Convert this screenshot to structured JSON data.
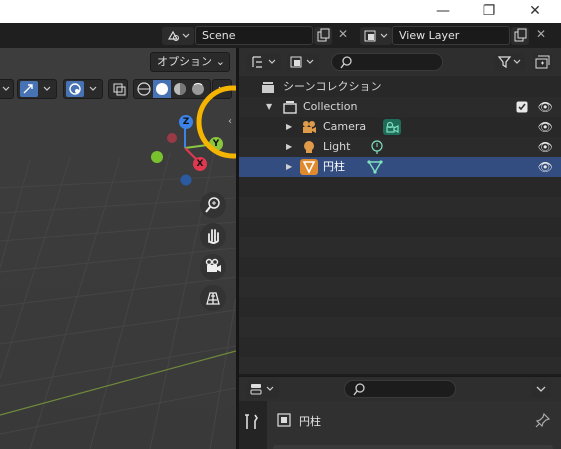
{
  "window": {
    "minimize_glyph": "—",
    "maximize_glyph": "❐",
    "close_glyph": "✕"
  },
  "topbar": {
    "scene_label": "Scene",
    "view_layer_label": "View Layer"
  },
  "viewport": {
    "options_label": "オプション",
    "gizmo": {
      "z_label": "Z",
      "y_label": "Y",
      "x_label": "X"
    },
    "tools": [
      "zoom-in-icon",
      "pan-hand-icon",
      "camera-view-icon",
      "grid-view-icon"
    ]
  },
  "outliner": {
    "scene_collection_label": "シーンコレクション",
    "items": [
      {
        "label": "Collection",
        "type": "collection",
        "checked": true,
        "visible": true
      },
      {
        "label": "Camera",
        "type": "camera",
        "visible": true
      },
      {
        "label": "Light",
        "type": "light",
        "visible": true
      },
      {
        "label": "円柱",
        "type": "mesh",
        "visible": true,
        "selected": true
      }
    ]
  },
  "properties": {
    "object_name": "円柱"
  },
  "colors": {
    "selection": "#334d80",
    "highlight_ring": "#f5b400",
    "axis_x": "#e0384f",
    "axis_y": "#8bc63f",
    "axis_z": "#3b83e8"
  }
}
